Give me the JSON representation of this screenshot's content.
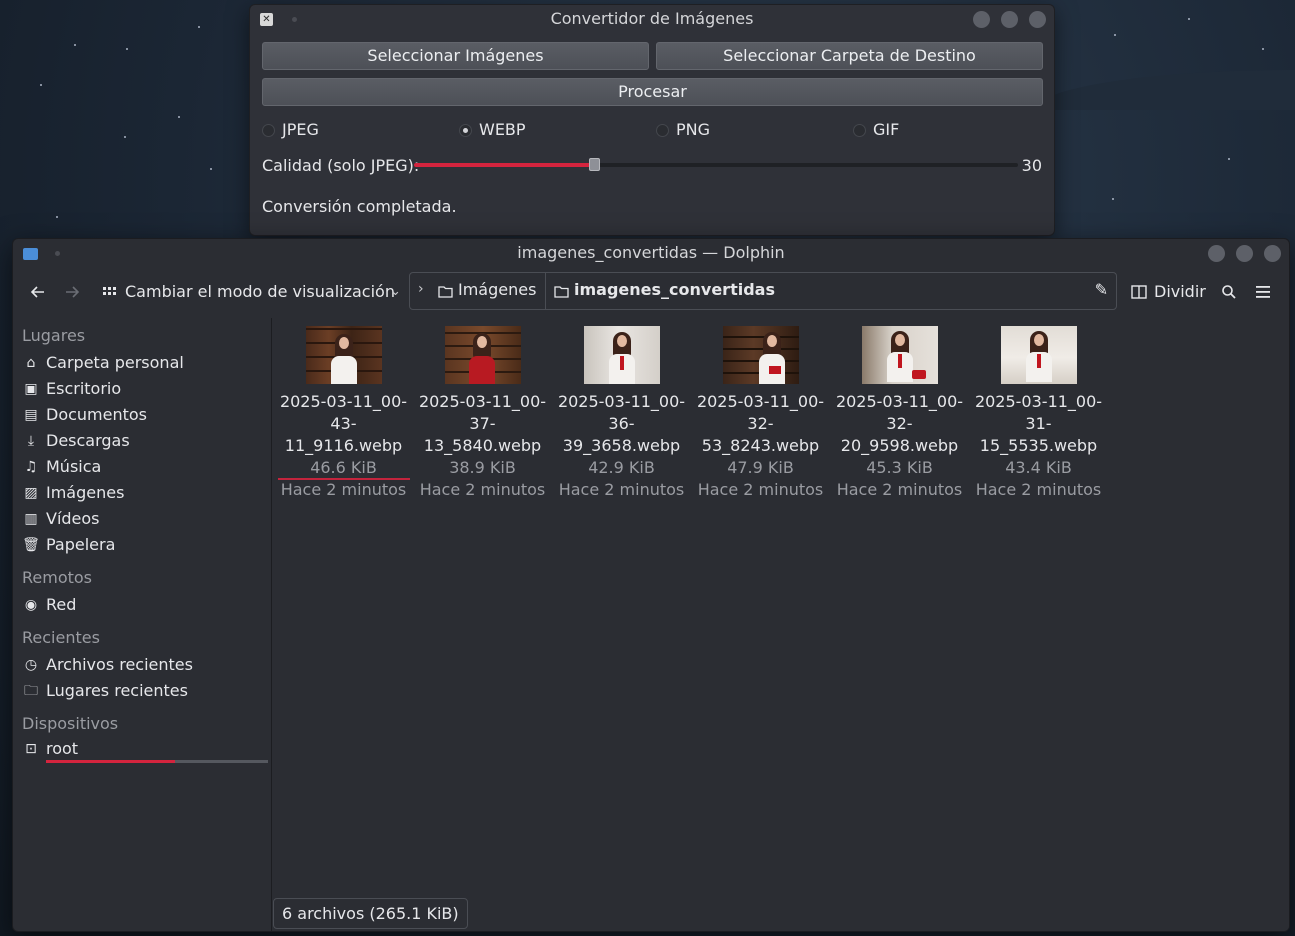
{
  "converter": {
    "title": "Convertidor de Imágenes",
    "select_images_label": "Seleccionar Imágenes",
    "select_folder_label": "Seleccionar Carpeta de Destino",
    "process_label": "Procesar",
    "formats": [
      {
        "label": "JPEG",
        "selected": false
      },
      {
        "label": "WEBP",
        "selected": true
      },
      {
        "label": "PNG",
        "selected": false
      },
      {
        "label": "GIF",
        "selected": false
      }
    ],
    "quality_label": "Calidad (solo JPEG):",
    "quality_value": "30",
    "quality_fraction": 0.3,
    "status": "Conversión completada."
  },
  "dolphin": {
    "title": "imagenes_convertidas — Dolphin",
    "view_mode_label": "Cambiar el modo de visualización",
    "breadcrumb": [
      "Imágenes",
      "imagenes_convertidas"
    ],
    "split_label": "Dividir",
    "sidebar": {
      "places_header": "Lugares",
      "places": [
        {
          "label": "Carpeta personal",
          "icon": "home-icon"
        },
        {
          "label": "Escritorio",
          "icon": "desktop-icon"
        },
        {
          "label": "Documentos",
          "icon": "documents-icon"
        },
        {
          "label": "Descargas",
          "icon": "downloads-icon"
        },
        {
          "label": "Música",
          "icon": "music-icon"
        },
        {
          "label": "Imágenes",
          "icon": "pictures-icon"
        },
        {
          "label": "Vídeos",
          "icon": "videos-icon"
        },
        {
          "label": "Papelera",
          "icon": "trash-icon"
        }
      ],
      "remote_header": "Remotos",
      "remote": [
        {
          "label": "Red",
          "icon": "network-icon"
        }
      ],
      "recent_header": "Recientes",
      "recent": [
        {
          "label": "Archivos recientes",
          "icon": "recent-files-icon"
        },
        {
          "label": "Lugares recientes",
          "icon": "recent-places-icon"
        }
      ],
      "devices_header": "Dispositivos",
      "devices": [
        {
          "label": "root",
          "icon": "drive-icon",
          "usage_fraction": 0.58
        }
      ]
    },
    "files": [
      {
        "name_line1": "2025-03-11_00-",
        "name_line2": "43-11_9116.webp",
        "size": "46.6 KiB",
        "modified": "Hace 2 minutos"
      },
      {
        "name_line1": "2025-03-11_00-",
        "name_line2": "37-13_5840.webp",
        "size": "38.9 KiB",
        "modified": "Hace 2 minutos"
      },
      {
        "name_line1": "2025-03-11_00-",
        "name_line2": "36-39_3658.webp",
        "size": "42.9 KiB",
        "modified": "Hace 2 minutos"
      },
      {
        "name_line1": "2025-03-11_00-",
        "name_line2": "32-53_8243.webp",
        "size": "47.9 KiB",
        "modified": "Hace 2 minutos"
      },
      {
        "name_line1": "2025-03-11_00-",
        "name_line2": "32-20_9598.webp",
        "size": "45.3 KiB",
        "modified": "Hace 2 minutos"
      },
      {
        "name_line1": "2025-03-11_00-",
        "name_line2": "31-15_5535.webp",
        "size": "43.4 KiB",
        "modified": "Hace 2 minutos"
      }
    ],
    "status": "6 archivos (265.1 KiB)"
  },
  "colors": {
    "accent": "#d4243e",
    "window_bg": "#2b2d33",
    "converter_bg": "#2f3138",
    "folder_icon": "#4b8ed8"
  }
}
